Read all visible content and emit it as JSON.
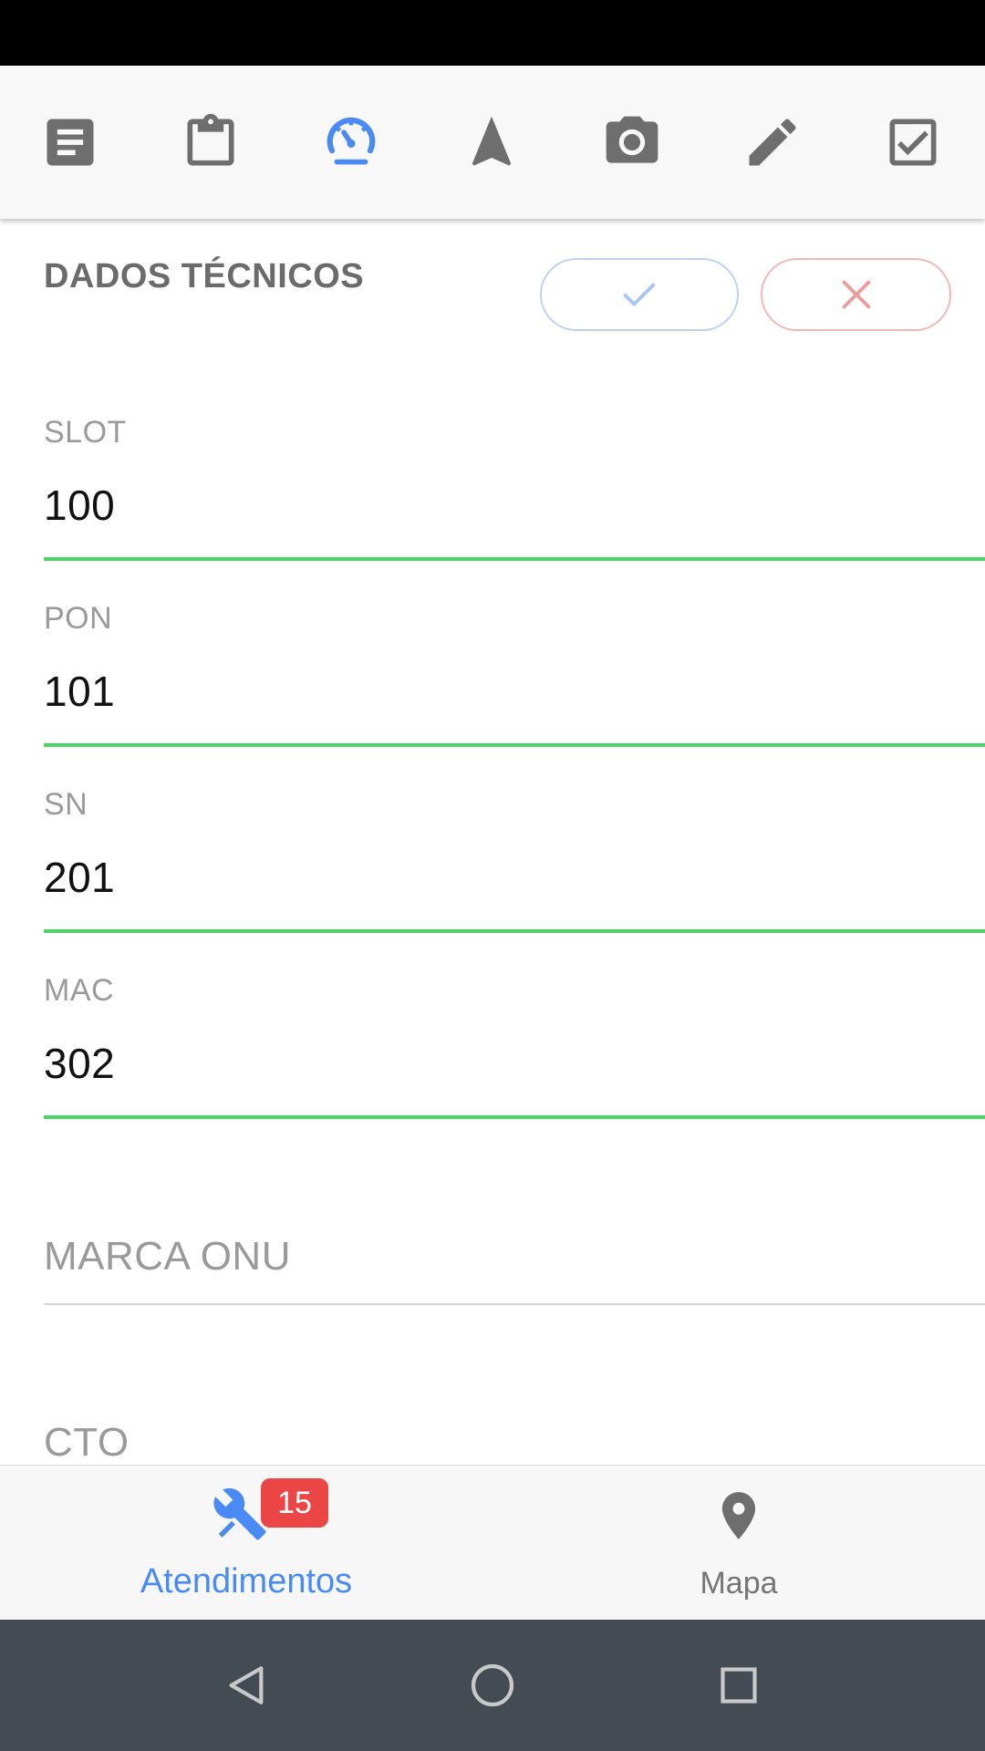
{
  "toolbar": {
    "icons": [
      "document-icon",
      "clipboard-icon",
      "speedometer-icon",
      "navigation-icon",
      "camera-icon",
      "pencil-icon",
      "checkbox-icon"
    ],
    "active_icon": "speedometer-icon",
    "active_color": "#4a8af4",
    "inactive_color": "#6e6e6e"
  },
  "section": {
    "title": "DADOS TÉCNICOS",
    "confirm_icon": "check-icon",
    "cancel_icon": "close-icon"
  },
  "fields": [
    {
      "label": "SLOT",
      "value": "100"
    },
    {
      "label": "PON",
      "value": "101"
    },
    {
      "label": "SN",
      "value": "201"
    },
    {
      "label": "MAC",
      "value": "302"
    },
    {
      "label": "MARCA ONU",
      "value": ""
    },
    {
      "label": "CTO",
      "value": ""
    }
  ],
  "bottom_nav": {
    "items": [
      {
        "label": "Atendimentos",
        "icon": "tools-icon",
        "badge": "15",
        "active": true
      },
      {
        "label": "Mapa",
        "icon": "map-pin-icon",
        "active": false
      }
    ]
  },
  "colors": {
    "valid_underline": "#4cd466",
    "badge": "#eb4545",
    "accent": "#4a8af4"
  }
}
